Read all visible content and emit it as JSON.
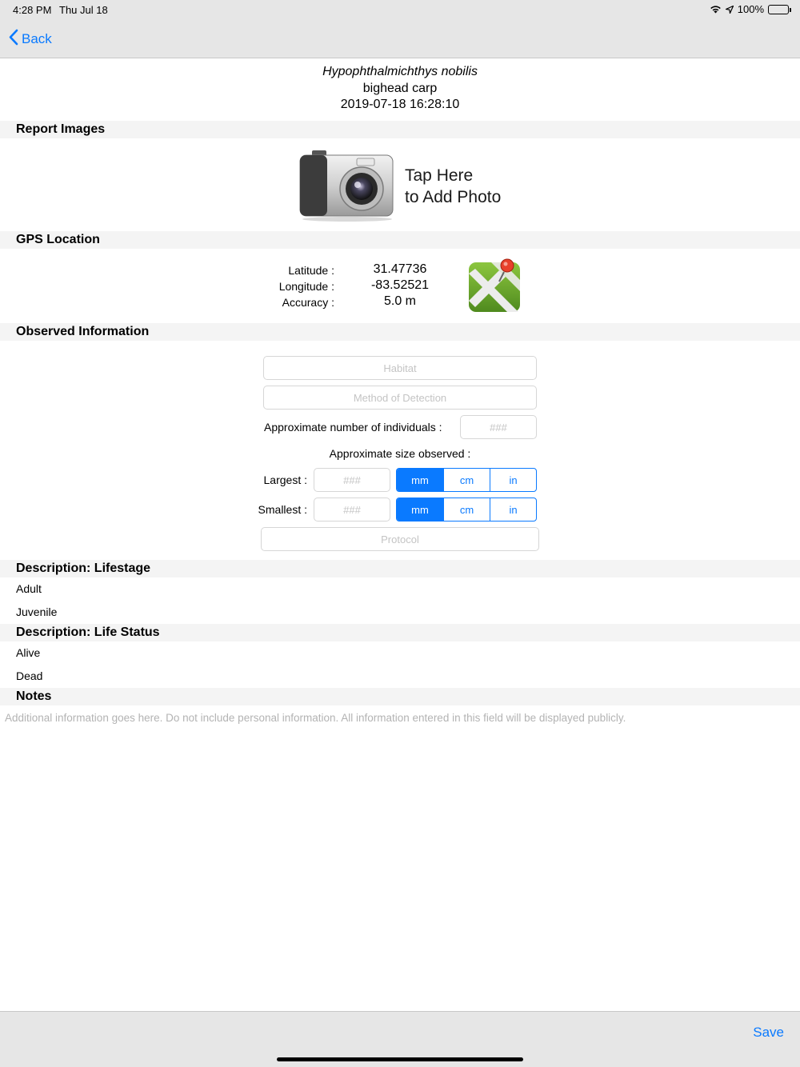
{
  "status_bar": {
    "time": "4:28 PM",
    "date": "Thu Jul 18",
    "battery": "100%"
  },
  "nav": {
    "back_label": "Back"
  },
  "species": {
    "scientific_name": "Hypophthalmichthys nobilis",
    "common_name": "bighead carp",
    "timestamp": "2019-07-18 16:28:10"
  },
  "sections": {
    "report_images": "Report Images",
    "gps_location": "GPS Location",
    "observed_information": "Observed Information",
    "lifestage": "Description: Lifestage",
    "life_status": "Description: Life Status",
    "notes": "Notes"
  },
  "photo": {
    "line1": "Tap Here",
    "line2": "to Add Photo"
  },
  "gps": {
    "latitude_label": "Latitude :",
    "longitude_label": "Longitude :",
    "accuracy_label": "Accuracy :",
    "latitude": "31.47736",
    "longitude": "-83.52521",
    "accuracy": "5.0 m"
  },
  "observed": {
    "habitat_placeholder": "Habitat",
    "method_placeholder": "Method of Detection",
    "individuals_label": "Approximate number of individuals :",
    "individuals_placeholder": "###",
    "size_label": "Approximate size observed :",
    "largest_label": "Largest :",
    "smallest_label": "Smallest :",
    "size_placeholder": "###",
    "units": [
      "mm",
      "cm",
      "in"
    ],
    "largest_selected": "mm",
    "smallest_selected": "mm",
    "protocol_placeholder": "Protocol"
  },
  "lifestage_items": [
    "Adult",
    "Juvenile"
  ],
  "life_status_items": [
    "Alive",
    "Dead"
  ],
  "notes": {
    "placeholder": "Additional information goes here. Do not include personal information. All information entered in this field will be displayed publicly."
  },
  "toolbar": {
    "save_label": "Save"
  },
  "colors": {
    "accent": "#0a7aff",
    "bar_background": "#e6e6e6",
    "section_background": "#f4f4f4"
  }
}
